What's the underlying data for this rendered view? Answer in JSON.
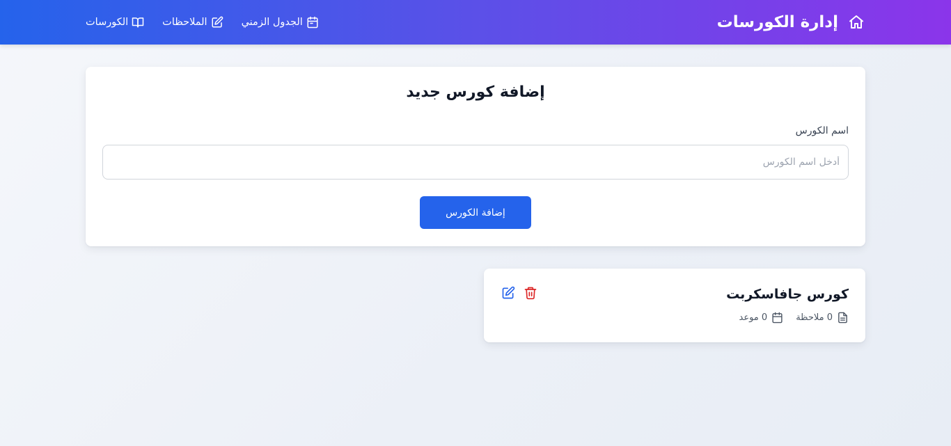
{
  "header": {
    "brand": "إدارة الكورسات",
    "nav": [
      {
        "label": "الكورسات",
        "icon": "book-open-icon"
      },
      {
        "label": "الملاحظات",
        "icon": "pencil-square-icon"
      },
      {
        "label": "الجدول الزمني",
        "icon": "calendar-icon"
      }
    ]
  },
  "form": {
    "title": "إضافة كورس جديد",
    "label": "اسم الكورس",
    "placeholder": "أدخل اسم الكورس",
    "value": "",
    "button": "إضافة الكورس"
  },
  "courses": [
    {
      "name": "كورس جافاسكربت",
      "notes": "0 ملاحظة",
      "appointments": "0 موعد"
    }
  ],
  "colors": {
    "header_start": "#2563eb",
    "header_end": "#8b35ea",
    "primary": "#2563eb",
    "danger": "#dc2626"
  }
}
